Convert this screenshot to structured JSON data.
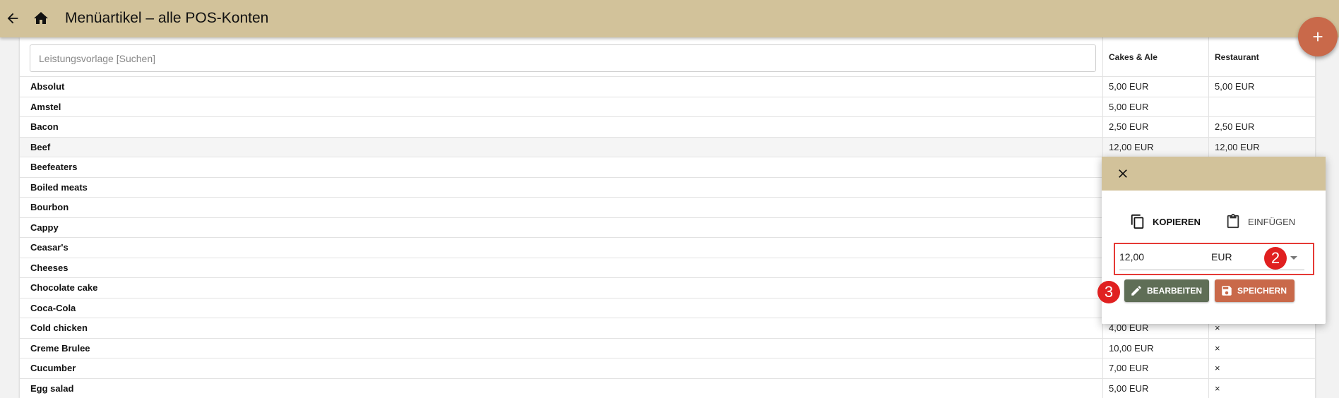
{
  "header": {
    "title": "Menüartikel – alle POS-Konten",
    "back_icon": "arrow-left-icon",
    "home_icon": "home-icon"
  },
  "fab": {
    "icon": "plus-icon",
    "color": "#c9694a"
  },
  "colors": {
    "header": "#d2c29a",
    "edit_button": "#5f6e56",
    "save_button": "#c9694a",
    "highlight": "#e53935"
  },
  "table": {
    "search_placeholder": "Leistungsvorlage [Suchen]",
    "columns": [
      "Cakes & Ale",
      "Restaurant"
    ],
    "rows": [
      {
        "name": "Absolut",
        "a": "5,00 EUR",
        "b": "5,00 EUR"
      },
      {
        "name": "Amstel",
        "a": "5,00 EUR",
        "b": ""
      },
      {
        "name": "Bacon",
        "a": "2,50 EUR",
        "b": "2,50 EUR"
      },
      {
        "name": "Beef",
        "a": "12,00 EUR",
        "b": "12,00 EUR"
      },
      {
        "name": "Beefeaters",
        "a": "",
        "b": ""
      },
      {
        "name": "Boiled meats",
        "a": "",
        "b": ""
      },
      {
        "name": "Bourbon",
        "a": "",
        "b": ""
      },
      {
        "name": "Cappy",
        "a": "",
        "b": ""
      },
      {
        "name": "Ceasar's",
        "a": "",
        "b": ""
      },
      {
        "name": "Cheeses",
        "a": "",
        "b": ""
      },
      {
        "name": "Chocolate cake",
        "a": "",
        "b": ""
      },
      {
        "name": "Coca-Cola",
        "a": "",
        "b": ""
      },
      {
        "name": "Cold chicken",
        "a": "4,00 EUR",
        "b": "×"
      },
      {
        "name": "Creme Brulee",
        "a": "10,00 EUR",
        "b": "×"
      },
      {
        "name": "Cucumber",
        "a": "7,00 EUR",
        "b": "×"
      },
      {
        "name": "Egg salad",
        "a": "5,00 EUR",
        "b": "×"
      }
    ]
  },
  "popup": {
    "close_icon": "close-icon",
    "copy_label": "KOPIEREN",
    "paste_label": "EINFÜGEN",
    "value": "12,00",
    "currency": "EUR",
    "edit_label": "BEARBEITEN",
    "save_label": "SPEICHERN",
    "badge_field": "2",
    "badge_edit": "3"
  }
}
